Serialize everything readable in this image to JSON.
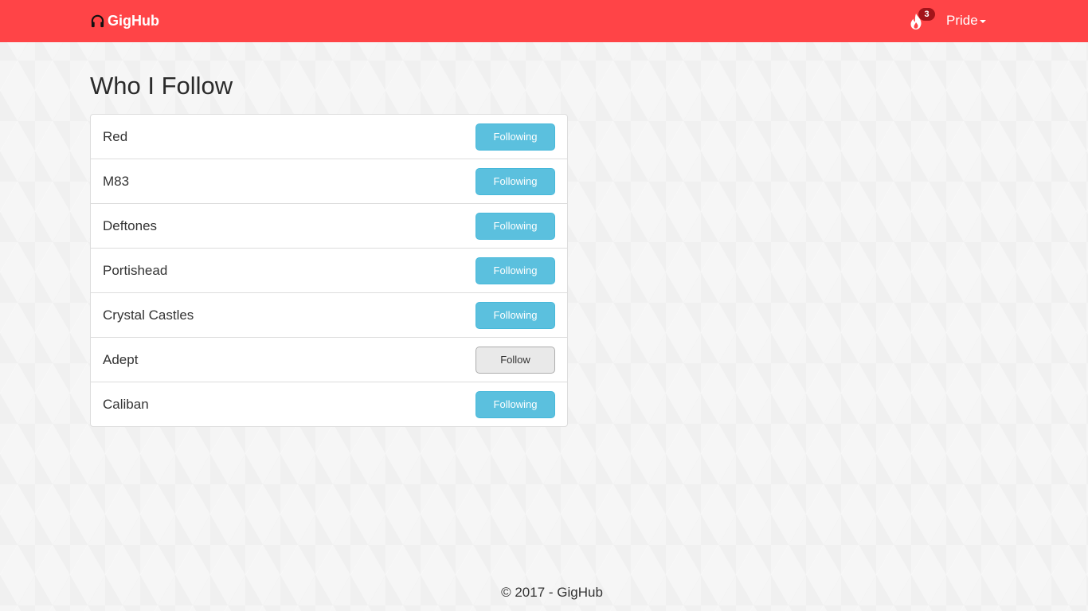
{
  "navbar": {
    "brand": "GigHub",
    "brand_icon": "headphones-icon",
    "notification_icon": "fire-icon",
    "notification_count": "3",
    "user_name": "Pride",
    "accent_color": "#ff4447"
  },
  "page": {
    "title": "Who I Follow"
  },
  "artists": [
    {
      "name": "Red",
      "button": "Following",
      "state": "following"
    },
    {
      "name": "M83",
      "button": "Following",
      "state": "following"
    },
    {
      "name": "Deftones",
      "button": "Following",
      "state": "following"
    },
    {
      "name": "Portishead",
      "button": "Following",
      "state": "following"
    },
    {
      "name": "Crystal Castles",
      "button": "Following",
      "state": "following"
    },
    {
      "name": "Adept",
      "button": "Follow",
      "state": "follow"
    },
    {
      "name": "Caliban",
      "button": "Following",
      "state": "following"
    }
  ],
  "colors": {
    "following_button": "#5bc0de",
    "follow_button": "#e9e9e9"
  },
  "footer": {
    "text": "© 2017 - GigHub"
  }
}
